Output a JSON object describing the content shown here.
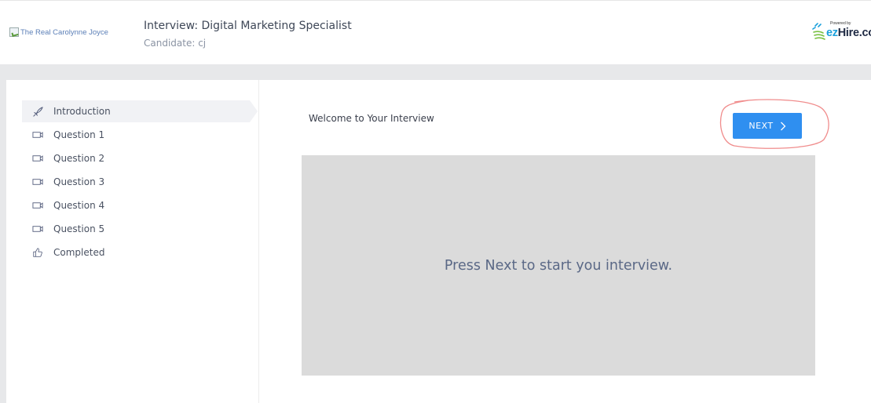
{
  "header": {
    "brand_alt": "The Real Carolynne Joyce",
    "title": "Interview: Digital Marketing Specialist",
    "candidate": "Candidate: cj",
    "ezhire_powered": "Powered by",
    "ezhire_ez": "ez",
    "ezhire_rest": "Hire.co"
  },
  "sidebar": {
    "items": [
      {
        "label": "Introduction",
        "icon": "rocket-icon",
        "active": true
      },
      {
        "label": "Question 1",
        "icon": "video-camera-icon"
      },
      {
        "label": "Question 2",
        "icon": "video-camera-icon"
      },
      {
        "label": "Question 3",
        "icon": "video-camera-icon"
      },
      {
        "label": "Question 4",
        "icon": "video-camera-icon"
      },
      {
        "label": "Question 5",
        "icon": "video-camera-icon"
      },
      {
        "label": "Completed",
        "icon": "thumbs-up-icon"
      }
    ]
  },
  "main": {
    "welcome": "Welcome to Your Interview",
    "next_label": "NEXT",
    "video_message": "Press Next to start you interview."
  },
  "colors": {
    "accent": "#2f8ff0",
    "annotation": "#f08c8c",
    "video_bg": "#dbdbdb"
  }
}
